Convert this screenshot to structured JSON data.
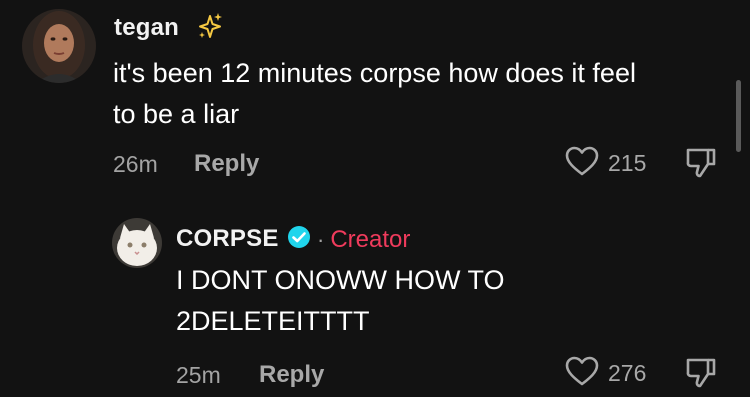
{
  "comment": {
    "username": "tegan",
    "username_icon": "sparkles-icon",
    "text_lines": [
      "it's been 12 minutes corpse how does it feel",
      "to be a liar"
    ],
    "time": "26m",
    "reply_label": "Reply",
    "likes": "215"
  },
  "reply": {
    "username": "CORPSE",
    "verified_icon": "verified-badge-icon",
    "separator": "·",
    "creator_label": "Creator",
    "text_lines": [
      "I DONT ONOWW HOW TO",
      "2DELETEITTTT"
    ],
    "time": "25m",
    "reply_label": "Reply",
    "likes": "276"
  },
  "colors": {
    "background": "#121212",
    "creator_accent": "#ef3b5c",
    "verified_blue": "#20d5ec",
    "muted_text": "#a3a3a3"
  }
}
